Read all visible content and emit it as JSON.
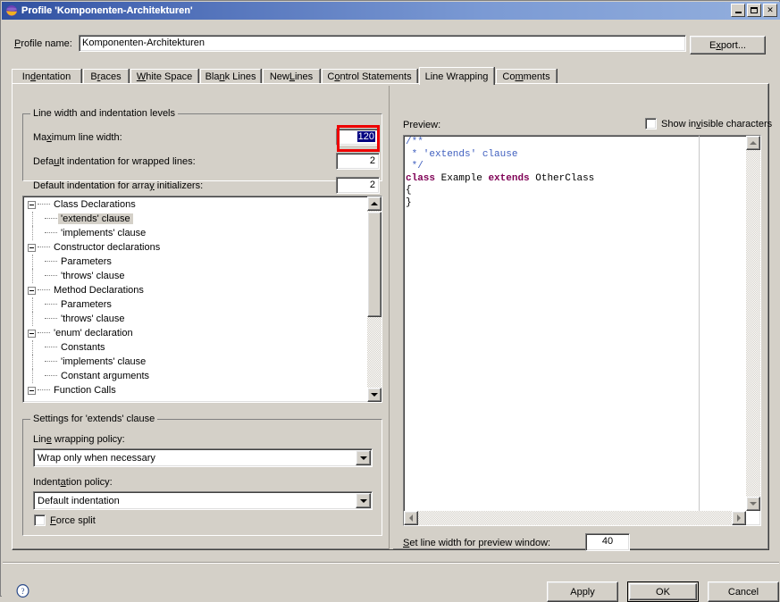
{
  "window": {
    "title": "Profile 'Komponenten-Architekturen'",
    "icon": "eclipse-globe-icon",
    "buttons": {
      "minimize": "minimize-button",
      "maximize": "maximize-button",
      "close": "✕"
    }
  },
  "profile": {
    "label": "Profile name:",
    "value": "Komponenten-Architekturen",
    "export_label": "Export..."
  },
  "tabs": [
    {
      "label": "Indentation",
      "selected": false
    },
    {
      "label": "Braces",
      "selected": false
    },
    {
      "label": "White Space",
      "selected": false
    },
    {
      "label": "Blank Lines",
      "selected": false
    },
    {
      "label": "New Lines",
      "selected": false
    },
    {
      "label": "Control Statements",
      "selected": false
    },
    {
      "label": "Line Wrapping",
      "selected": true
    },
    {
      "label": "Comments",
      "selected": false
    }
  ],
  "line_width_group": {
    "title": "Line width and indentation levels",
    "fields": [
      {
        "label": "Maximum line width:",
        "value": "120",
        "selected": true,
        "highlighted": true
      },
      {
        "label": "Default indentation for wrapped lines:",
        "value": "2",
        "selected": false,
        "highlighted": false
      },
      {
        "label": "Default indentation for array initializers:",
        "value": "2",
        "selected": false,
        "highlighted": false
      }
    ]
  },
  "tree": {
    "nodes": [
      {
        "label": "Class Declarations",
        "level": 0,
        "expanded": true,
        "selected": false
      },
      {
        "label": "'extends' clause",
        "level": 1,
        "expanded": false,
        "selected": true
      },
      {
        "label": "'implements' clause",
        "level": 1,
        "expanded": false,
        "selected": false
      },
      {
        "label": "Constructor declarations",
        "level": 0,
        "expanded": true,
        "selected": false
      },
      {
        "label": "Parameters",
        "level": 1,
        "expanded": false,
        "selected": false
      },
      {
        "label": "'throws' clause",
        "level": 1,
        "expanded": false,
        "selected": false
      },
      {
        "label": "Method Declarations",
        "level": 0,
        "expanded": true,
        "selected": false
      },
      {
        "label": "Parameters",
        "level": 1,
        "expanded": false,
        "selected": false
      },
      {
        "label": "'throws' clause",
        "level": 1,
        "expanded": false,
        "selected": false
      },
      {
        "label": "'enum' declaration",
        "level": 0,
        "expanded": true,
        "selected": false
      },
      {
        "label": "Constants",
        "level": 1,
        "expanded": false,
        "selected": false
      },
      {
        "label": "'implements' clause",
        "level": 1,
        "expanded": false,
        "selected": false
      },
      {
        "label": "Constant arguments",
        "level": 1,
        "expanded": false,
        "selected": false
      },
      {
        "label": "Function Calls",
        "level": 0,
        "expanded": true,
        "selected": false
      }
    ]
  },
  "settings_group": {
    "title": "Settings for 'extends' clause",
    "wrapping_label": "Line wrapping policy:",
    "wrapping_value": "Wrap only when necessary",
    "indentation_label": "Indentation policy:",
    "indentation_value": "Default indentation",
    "force_split_label": "Force split",
    "force_split_checked": false
  },
  "preview": {
    "label": "Preview:",
    "show_invisible_label": "Show invisible characters",
    "show_invisible_checked": false,
    "code_lines": [
      {
        "text": "/**",
        "style": "comment"
      },
      {
        "text": " * 'extends' clause",
        "style": "comment"
      },
      {
        "text": " */",
        "style": "comment"
      },
      {
        "text": "class Example extends OtherClass",
        "style": "code"
      },
      {
        "text": "{",
        "style": "code"
      },
      {
        "text": "}",
        "style": "code"
      }
    ],
    "code_keywords": [
      "class",
      "extends"
    ],
    "set_line_width_label": "Set line width for preview window:",
    "set_line_width_value": "40"
  },
  "footer": {
    "help": "help-icon",
    "apply": "Apply",
    "ok": "OK",
    "cancel": "Cancel"
  },
  "colors": {
    "titlebar_start": "#2f4f9f",
    "titlebar_end": "#93afdd",
    "dialog_bg": "#d4d0c8",
    "selection_bg": "#000080",
    "tree_selection_bg": "#d4d0c8",
    "comment": "#3f5fbf",
    "keyword": "#7f0055",
    "annotation_red": "#ee0000"
  }
}
